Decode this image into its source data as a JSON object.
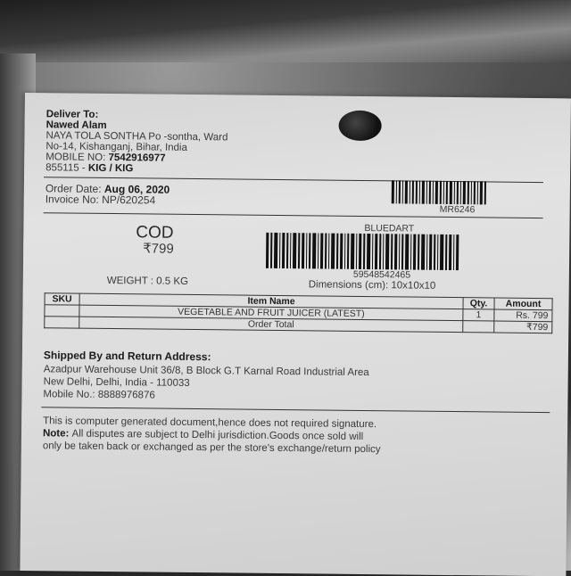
{
  "deliver_to": {
    "heading": "Deliver To:",
    "name": "Nawed Alam",
    "address_line1": "NAYA TOLA SONTHA Po -sontha, Ward",
    "address_line2": "No-14, Kishanganj, Bihar, India",
    "mobile_label": "MOBILE NO: ",
    "mobile": "7542916977",
    "pin_prefix": "855115 - ",
    "pin_code": "KIG / KIG"
  },
  "order": {
    "date_label": "Order Date: ",
    "date": "Aug 06, 2020",
    "invoice_label": "Invoice No: ",
    "invoice": "NP/620254",
    "barcode_small_text": "MR6246"
  },
  "payment": {
    "mode": "COD",
    "amount": "₹799",
    "courier": "BLUEDART",
    "awb": "59548542465",
    "weight": "WEIGHT : 0.5 KG",
    "dimensions": "Dimensions (cm): 10x10x10"
  },
  "items_table": {
    "headers": [
      "SKU",
      "Item Name",
      "Qty.",
      "Amount"
    ],
    "rows": [
      {
        "sku": "",
        "name": "VEGETABLE AND FRUIT JUICER (LATEST)",
        "qty": "1",
        "amount": "Rs. 799"
      }
    ],
    "total_label": "Order Total",
    "total": "₹799"
  },
  "return_address": {
    "heading": "Shipped By and Return Address:",
    "line1": "Azadpur Warehouse Unit 36/8, B Block G.T Karnal Road Industrial Area",
    "line2": "New Delhi, Delhi, India - 110033",
    "mobile": "Mobile No.: 8888976876"
  },
  "footer": {
    "line1": "This is computer generated document,hence does not required signature.",
    "note_label": "Note: ",
    "line2": "All disputes are subject to Delhi jurisdiction.Goods once sold will",
    "line3": "only be taken back or exchanged as per the store's exchange/return policy"
  }
}
